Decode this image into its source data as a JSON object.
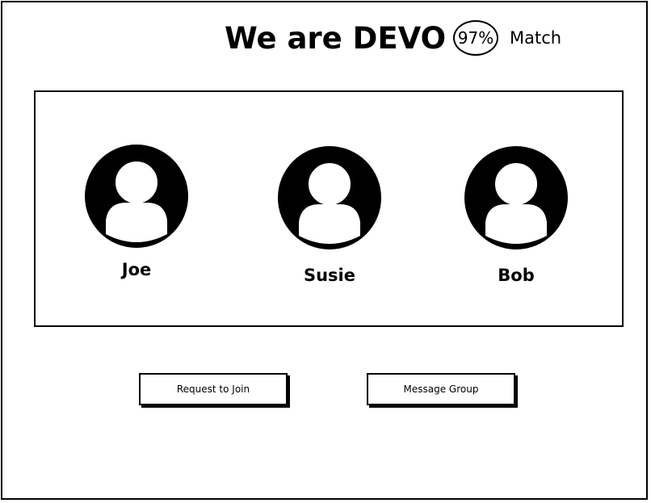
{
  "header": {
    "title": "We are DEVO",
    "match_percent": "97%",
    "match_label": "Match"
  },
  "members": [
    {
      "name": "Joe",
      "icon": "user-avatar-icon"
    },
    {
      "name": "Susie",
      "icon": "user-avatar-icon"
    },
    {
      "name": "Bob",
      "icon": "user-avatar-icon"
    }
  ],
  "actions": {
    "request_label": "Request to Join",
    "message_label": "Message Group"
  },
  "colors": {
    "ink": "#000000",
    "background": "#ffffff"
  }
}
